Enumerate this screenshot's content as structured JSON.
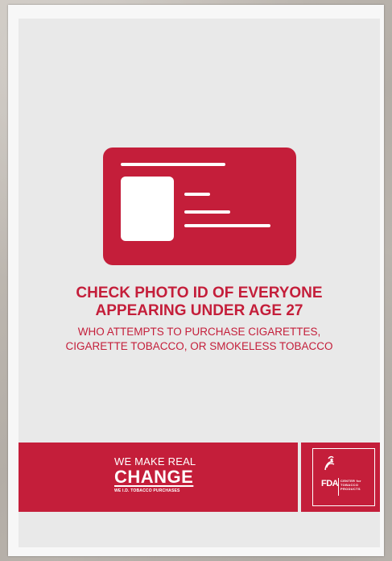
{
  "poster": {
    "headline_line1": "CHECK PHOTO ID OF EVERYONE",
    "headline_line2": "APPEARING UNDER AGE 27",
    "sub_line1": "WHO ATTEMPTS TO PURCHASE CIGARETTES,",
    "sub_line2": "CIGARETTE TOBACCO, OR SMOKELESS TOBACCO"
  },
  "slogan": {
    "line1": "WE MAKE REAL",
    "line2": "CHANGE",
    "line3": "WE I.D. TOBACCO PURCHASES"
  },
  "fda_logo": {
    "agency": "FDA",
    "center_name": [
      "CENTER for",
      "TOBACCO",
      "PRODUCTS"
    ]
  },
  "colors": {
    "brand_red": "#c41e3a",
    "poster_gray": "#e9e9e9",
    "frame_white": "#f7f7f7"
  },
  "icons": [
    "id-card-icon",
    "hhs-eagle-icon"
  ]
}
